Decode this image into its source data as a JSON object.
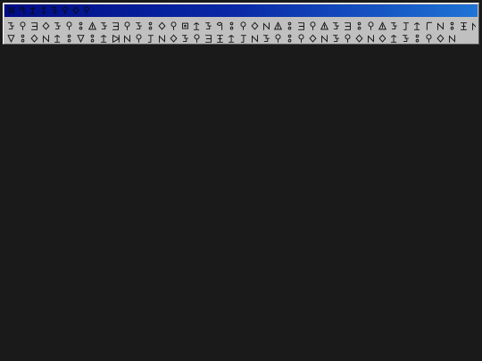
{
  "window": {
    "title_glyphs": [
      "square-dot",
      "loop",
      "fork",
      "rings",
      "hook-s",
      "lollipop",
      "diamond",
      "lollipop"
    ]
  },
  "content": {
    "rows": [
      [
        "hook-s",
        "lollipop",
        "e-bracket",
        "diamond",
        "hook-s",
        "lollipop",
        "rings",
        "tri-bar",
        "hook-s",
        "e-bracket",
        "lollipop",
        "hook-s",
        "rings",
        "diamond",
        "lollipop",
        "square-dot",
        "fork",
        "hook-s",
        "loop",
        "rings",
        "lollipop",
        "diamond",
        "n-shape",
        "tri-bar",
        "rings",
        "e-bracket",
        "lollipop",
        "tri-bar",
        "hook-s",
        "e-bracket",
        "rings",
        "lollipop",
        "tri-bar",
        "hook-s",
        "stick-t",
        "fork",
        "stick-f",
        "n-shape",
        "rings",
        "i-bar",
        "n-shape"
      ],
      [
        "tri-down",
        "rings",
        "diamond",
        "n-shape",
        "fork",
        "rings",
        "tri-down",
        "rings",
        "fork",
        "tri-right",
        "n-shape",
        "lollipop",
        "stick-t",
        "n-shape",
        "diamond",
        "hook-s",
        "lollipop",
        "e-bracket",
        "i-bar",
        "fork",
        "stick-t",
        "n-shape",
        "hook-s",
        "lollipop",
        "rings",
        "lollipop",
        "diamond",
        "n-shape",
        "hook-s",
        "lollipop",
        "diamond",
        "n-shape",
        "diamond",
        "fork",
        "hook-s",
        "rings",
        "lollipop",
        "diamond",
        "n-shape"
      ]
    ]
  }
}
